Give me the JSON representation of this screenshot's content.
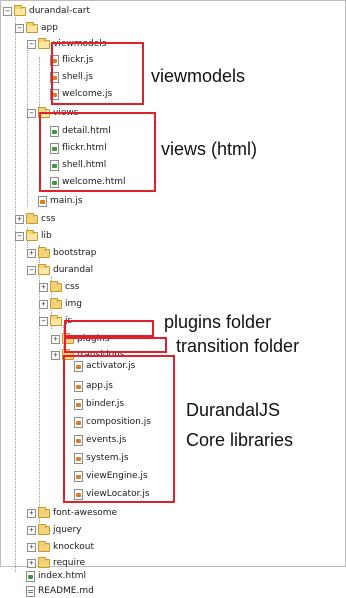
{
  "tree": {
    "root": "durandal-cart",
    "app": "app",
    "viewmodels": "viewmodels",
    "viewmodel_files": [
      "flickr.js",
      "shell.js",
      "welcome.js"
    ],
    "views": "views",
    "view_files": [
      "detail.html",
      "flickr.html",
      "shell.html",
      "welcome.html"
    ],
    "main": "main.js",
    "css": "css",
    "lib": "lib",
    "bootstrap": "bootstrap",
    "durandal": "durandal",
    "durandal_css": "css",
    "durandal_img": "img",
    "durandal_js": "js",
    "plugins": "plugins",
    "transitions": "transitions",
    "core_files": [
      "activator.js",
      "app.js",
      "binder.js",
      "composition.js",
      "events.js",
      "system.js",
      "viewEngine.js",
      "viewLocator.js"
    ],
    "font_awesome": "font-awesome",
    "jquery": "jquery",
    "knockout": "knockout",
    "require": "require",
    "index": "index.html",
    "readme": "README.md"
  },
  "annotations": {
    "viewmodels": "viewmodels",
    "views": "views (html)",
    "plugins": "plugins folder",
    "transitions": "transition folder",
    "core_line1": "DurandalJS",
    "core_line2": "Core libraries"
  },
  "colors": {
    "highlight": "#e0202a",
    "folder": "#f4d27a",
    "js_icon": "#e07b22",
    "html_icon": "#3c9a3c"
  }
}
